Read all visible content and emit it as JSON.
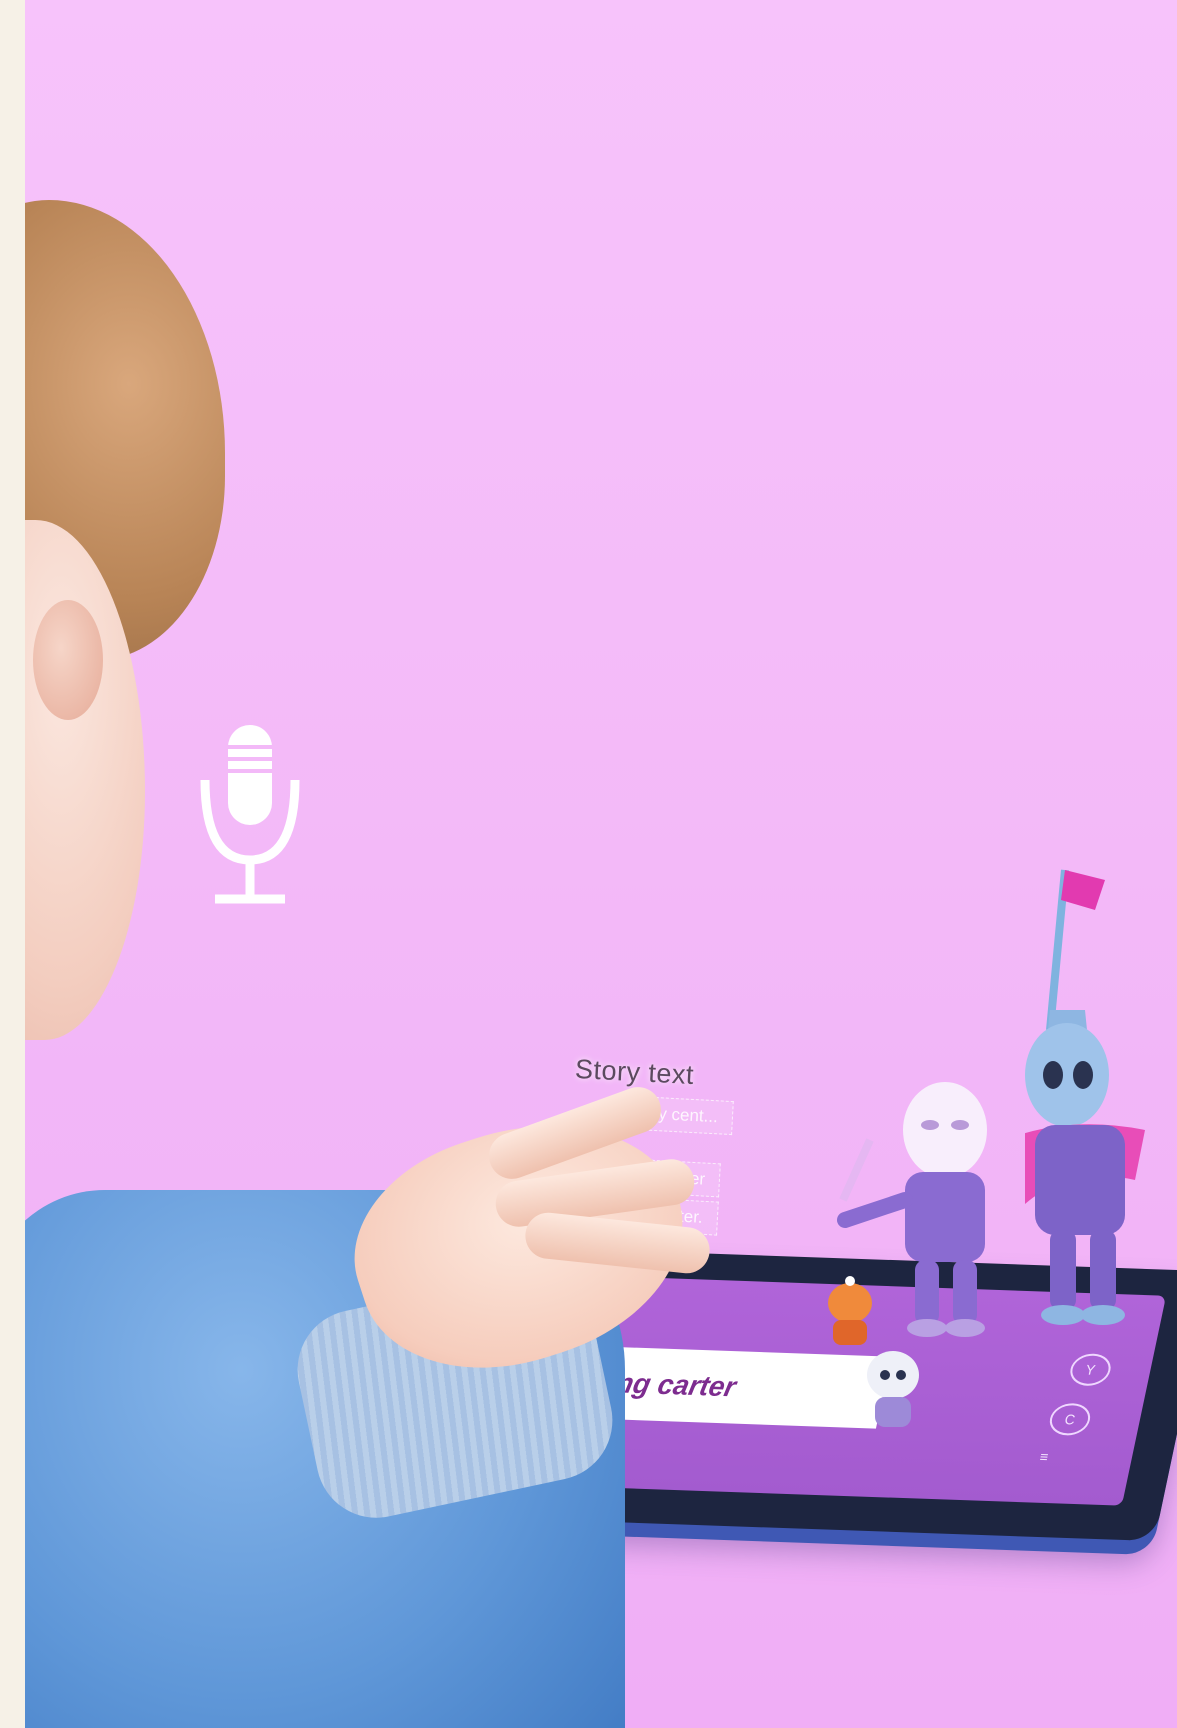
{
  "hologram": {
    "title": "Story text",
    "lines": [
      "story cent...",
      "tatory chrater",
      "... yeruntacter."
    ]
  },
  "tablet": {
    "banner_text": "Jling carter",
    "controls": [
      "Y",
      "C",
      "≡"
    ]
  },
  "colors": {
    "background": "#f5bcf9",
    "tablet_screen": "#a95fd3",
    "sweater": "#5f97d8",
    "flag": "#e23ab0"
  },
  "icons": {
    "microphone": "microphone-icon",
    "flag": "flag-icon"
  }
}
